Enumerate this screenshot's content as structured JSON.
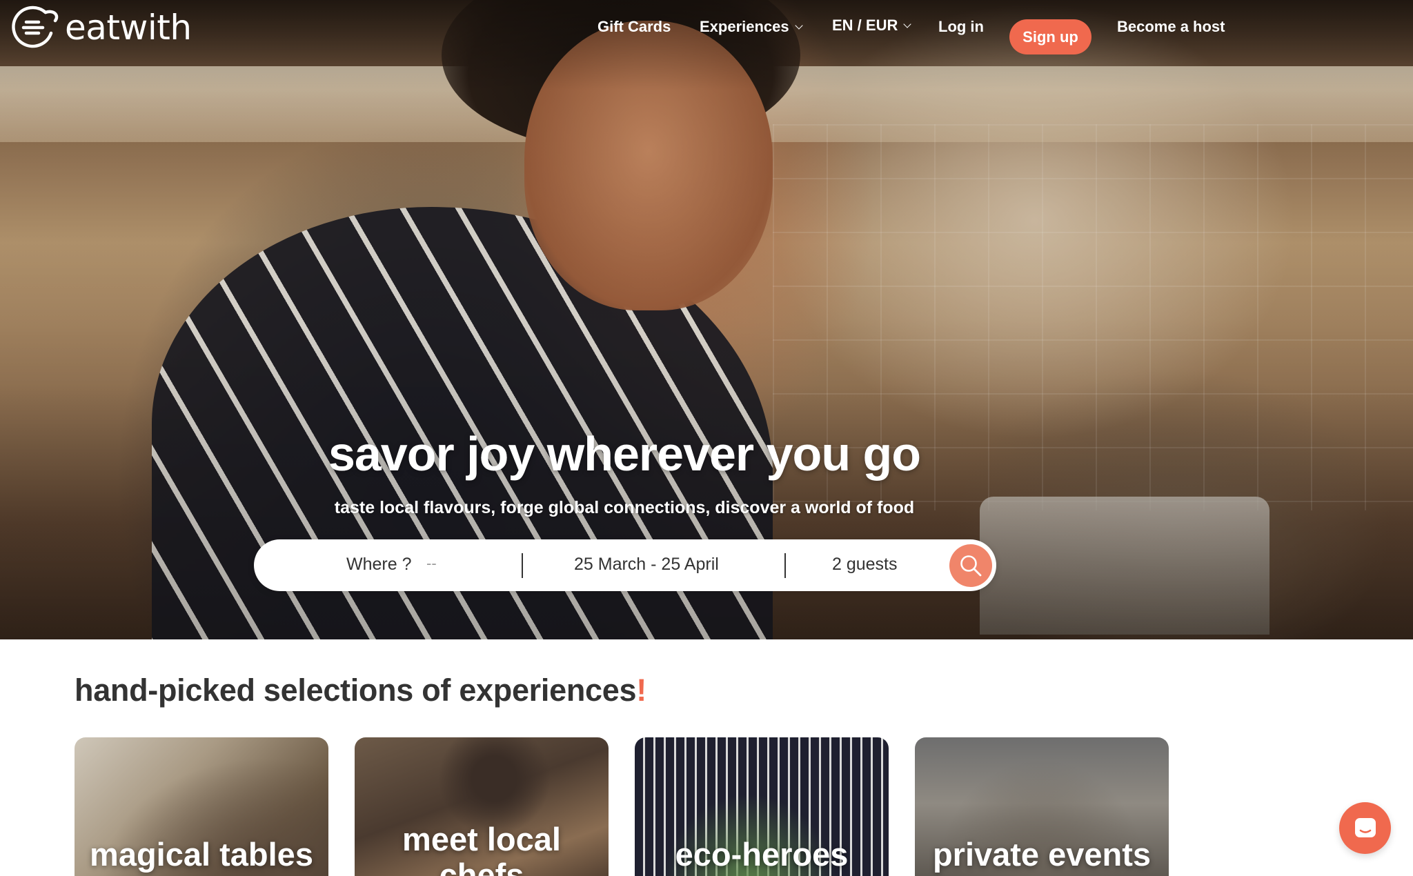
{
  "brand": {
    "name": "eatwith"
  },
  "nav": {
    "gift_cards": "Gift Cards",
    "experiences": "Experiences",
    "locale": "EN / EUR",
    "login": "Log in",
    "signup": "Sign up",
    "become_host": "Become a host"
  },
  "hero": {
    "title": "savor joy wherever you go",
    "subtitle": "taste local flavours, forge global connections, discover a world of food"
  },
  "search": {
    "where_label": "Where ?",
    "where_placeholder": "--",
    "dates": "25 March - 25 April",
    "guests": "2 guests"
  },
  "section": {
    "title": "hand-picked selections of experiences",
    "title_suffix": "!"
  },
  "cards": [
    {
      "label": "magical tables"
    },
    {
      "label": "meet local chefs"
    },
    {
      "label": "eco-heroes"
    },
    {
      "label": "private events"
    }
  ],
  "colors": {
    "accent": "#f0694e",
    "search_button": "#f0856a",
    "text_dark": "#333333"
  },
  "icons": {
    "search": "search-icon",
    "chat": "chat-icon",
    "logo": "eatwith-logo-icon"
  }
}
